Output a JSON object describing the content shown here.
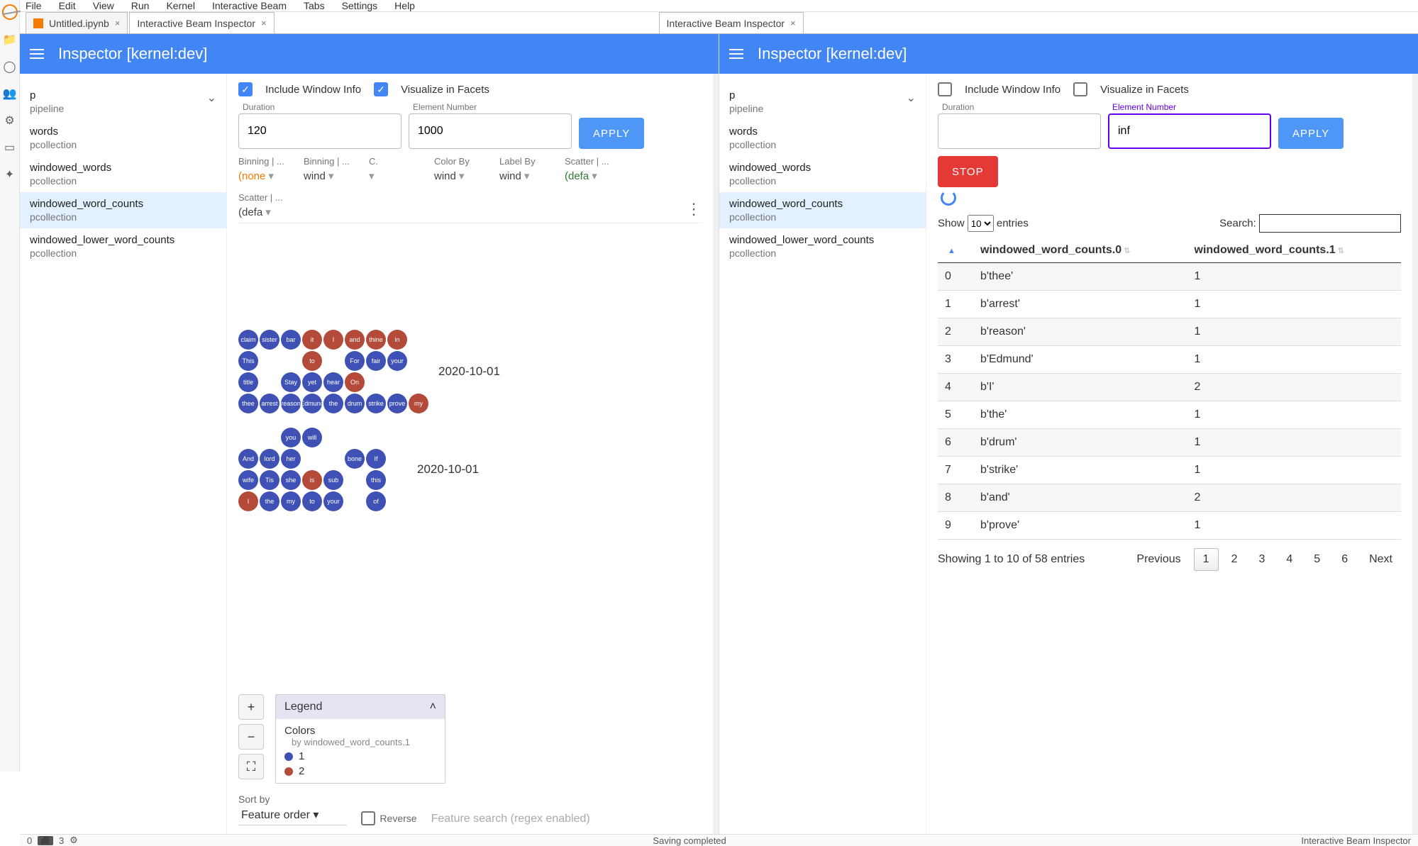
{
  "menubar": [
    "File",
    "Edit",
    "View",
    "Run",
    "Kernel",
    "Interactive Beam",
    "Tabs",
    "Settings",
    "Help"
  ],
  "tabs": [
    {
      "label": "Untitled.ipynb",
      "closable": true,
      "icon": "notebook"
    },
    {
      "label": "Interactive Beam Inspector",
      "closable": true
    },
    {
      "label": "Interactive Beam Inspector",
      "closable": true
    }
  ],
  "inspector_title": "Inspector [kernel:dev]",
  "sidebar_items": [
    {
      "name": "p",
      "type": "pipeline",
      "expandable": true
    },
    {
      "name": "words",
      "type": "pcollection"
    },
    {
      "name": "windowed_words",
      "type": "pcollection"
    },
    {
      "name": "windowed_word_counts",
      "type": "pcollection"
    },
    {
      "name": "windowed_lower_word_counts",
      "type": "pcollection"
    }
  ],
  "left": {
    "include_window_info": true,
    "visualize_in_facets": true,
    "labels": {
      "include": "Include Window Info",
      "visualize": "Visualize in Facets",
      "duration": "Duration",
      "element": "Element Number",
      "apply": "APPLY"
    },
    "duration": "120",
    "element": "1000",
    "facets_controls": [
      {
        "label": "Binning | ...",
        "val": "(none",
        "cls": "orange"
      },
      {
        "label": "Binning | ...",
        "val": "wind"
      },
      {
        "label": "C.",
        "val": ""
      },
      {
        "label": "Color By",
        "val": "wind"
      },
      {
        "label": "Label By",
        "val": "wind"
      },
      {
        "label": "Scatter | ...",
        "val": "(defa",
        "cls": "green"
      },
      {
        "label": "Scatter | ...",
        "val": "(defa"
      }
    ],
    "bubble_groups": [
      {
        "date": "2020-10-01",
        "rows": [
          [
            "claim",
            "sister",
            "bar",
            "it|r",
            "I|r",
            "and|r",
            "thine|r",
            "in|r"
          ],
          [
            "This",
            "",
            "",
            "to|r",
            "",
            "For",
            "fair",
            "your"
          ],
          [
            "title",
            "",
            "Stay",
            "yet",
            "hear",
            "On|r",
            "",
            "",
            ""
          ],
          [
            "thee",
            "arrest",
            "reason",
            "Edmund",
            "the",
            "drum",
            "strike",
            "prove",
            "my|r"
          ]
        ]
      },
      {
        "date": "2020-10-01",
        "rows": [
          [
            "",
            "",
            "you",
            "will",
            "",
            "",
            "",
            ""
          ],
          [
            "And",
            "lord",
            "her",
            "",
            "",
            "bone",
            "If"
          ],
          [
            "wife",
            "Tis",
            "she",
            "is|r",
            "sub",
            "",
            "this"
          ],
          [
            "I|r",
            "the",
            "my",
            "to",
            "your",
            "",
            "of"
          ]
        ]
      }
    ],
    "legend": {
      "title": "Legend",
      "section": "Colors",
      "by": "by windowed_word_counts.1",
      "items": [
        {
          "color": "blue",
          "label": "1"
        },
        {
          "color": "red",
          "label": "2"
        }
      ]
    },
    "sort": {
      "label": "Sort by",
      "value": "Feature order",
      "reverse_label": "Reverse",
      "search_placeholder": "Feature search (regex enabled)"
    }
  },
  "right": {
    "include_window_info": false,
    "visualize_in_facets": false,
    "labels": {
      "include": "Include Window Info",
      "visualize": "Visualize in Facets",
      "duration": "Duration",
      "element": "Element Number",
      "apply": "APPLY",
      "stop": "STOP"
    },
    "duration": "",
    "element": "inf",
    "table": {
      "show_label_a": "Show",
      "show_value": "10",
      "show_label_b": "entries",
      "search_label": "Search:",
      "search_value": "",
      "columns": [
        "",
        "windowed_word_counts.0",
        "windowed_word_counts.1"
      ],
      "rows": [
        [
          "0",
          "b'thee'",
          "1"
        ],
        [
          "1",
          "b'arrest'",
          "1"
        ],
        [
          "2",
          "b'reason'",
          "1"
        ],
        [
          "3",
          "b'Edmund'",
          "1"
        ],
        [
          "4",
          "b'I'",
          "2"
        ],
        [
          "5",
          "b'the'",
          "1"
        ],
        [
          "6",
          "b'drum'",
          "1"
        ],
        [
          "7",
          "b'strike'",
          "1"
        ],
        [
          "8",
          "b'and'",
          "2"
        ],
        [
          "9",
          "b'prove'",
          "1"
        ]
      ],
      "info": "Showing 1 to 10 of 58 entries",
      "pager": {
        "prev": "Previous",
        "pages": [
          "1",
          "2",
          "3",
          "4",
          "5",
          "6"
        ],
        "next": "Next",
        "current": "1"
      }
    }
  },
  "statusbar": {
    "left_num": "0",
    "left_badges": [
      "3"
    ],
    "center": "Saving completed",
    "right": "Interactive Beam Inspector"
  }
}
